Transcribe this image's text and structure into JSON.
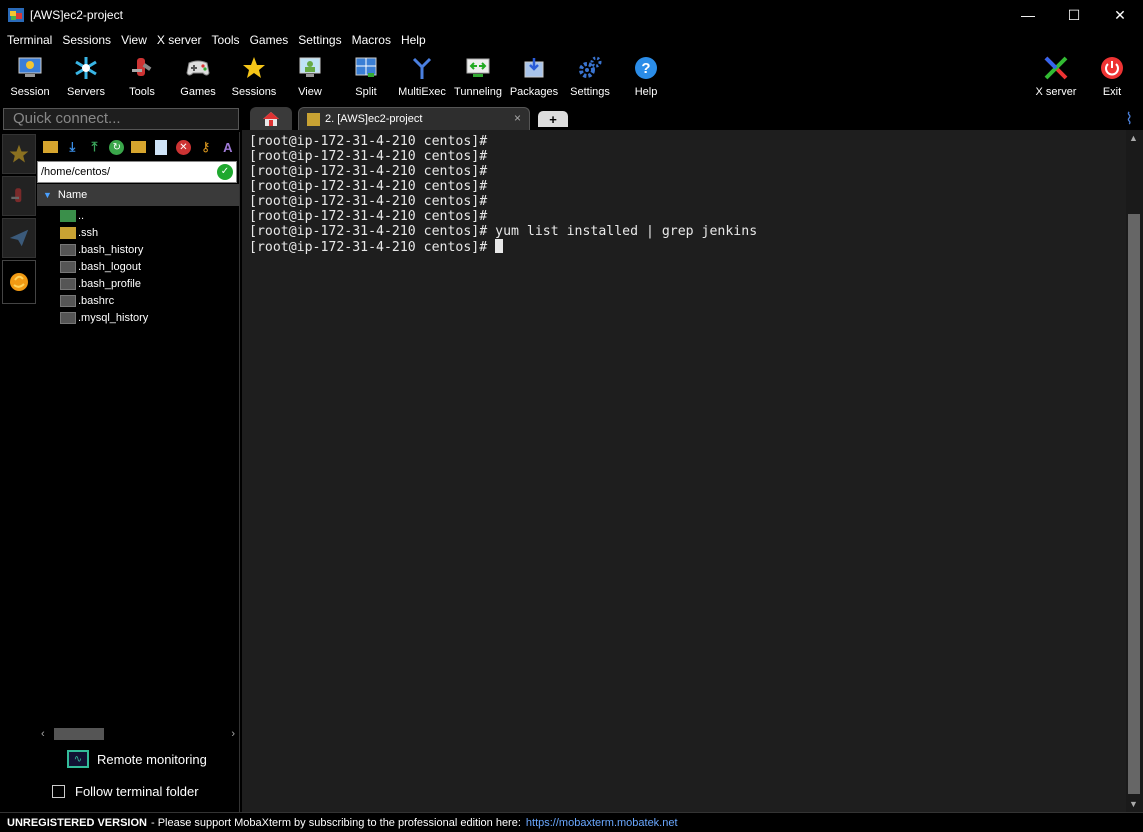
{
  "window": {
    "title": "[AWS]ec2-project",
    "min": "—",
    "max": "☐",
    "close": "✕"
  },
  "menu": [
    "Terminal",
    "Sessions",
    "View",
    "X server",
    "Tools",
    "Games",
    "Settings",
    "Macros",
    "Help"
  ],
  "toolbar": {
    "session": "Session",
    "servers": "Servers",
    "tools": "Tools",
    "games": "Games",
    "sessions": "Sessions",
    "view": "View",
    "split": "Split",
    "multiexec": "MultiExec",
    "tunneling": "Tunneling",
    "packages": "Packages",
    "settings": "Settings",
    "help": "Help",
    "xserver": "X server",
    "exit": "Exit"
  },
  "quick_connect": {
    "placeholder": "Quick connect..."
  },
  "sidebar": {
    "path": "/home/centos/",
    "column": "Name",
    "files": [
      "..",
      ".ssh",
      ".bash_history",
      ".bash_logout",
      ".bash_profile",
      ".bashrc",
      ".mysql_history"
    ],
    "remote_monitoring": "Remote monitoring",
    "follow_terminal": "Follow terminal folder"
  },
  "tabs": {
    "session_label": "2. [AWS]ec2-project",
    "close": "×",
    "new": "+"
  },
  "terminal": {
    "lines": [
      "[root@ip-172-31-4-210 centos]#",
      "[root@ip-172-31-4-210 centos]#",
      "[root@ip-172-31-4-210 centos]#",
      "[root@ip-172-31-4-210 centos]#",
      "[root@ip-172-31-4-210 centos]#",
      "[root@ip-172-31-4-210 centos]#",
      "[root@ip-172-31-4-210 centos]# yum list installed | grep jenkins",
      "[root@ip-172-31-4-210 centos]# "
    ]
  },
  "status": {
    "unregistered": "UNREGISTERED VERSION",
    "message": "-  Please support MobaXterm by subscribing to the professional edition here:",
    "link": "https://mobaxterm.mobatek.net"
  }
}
